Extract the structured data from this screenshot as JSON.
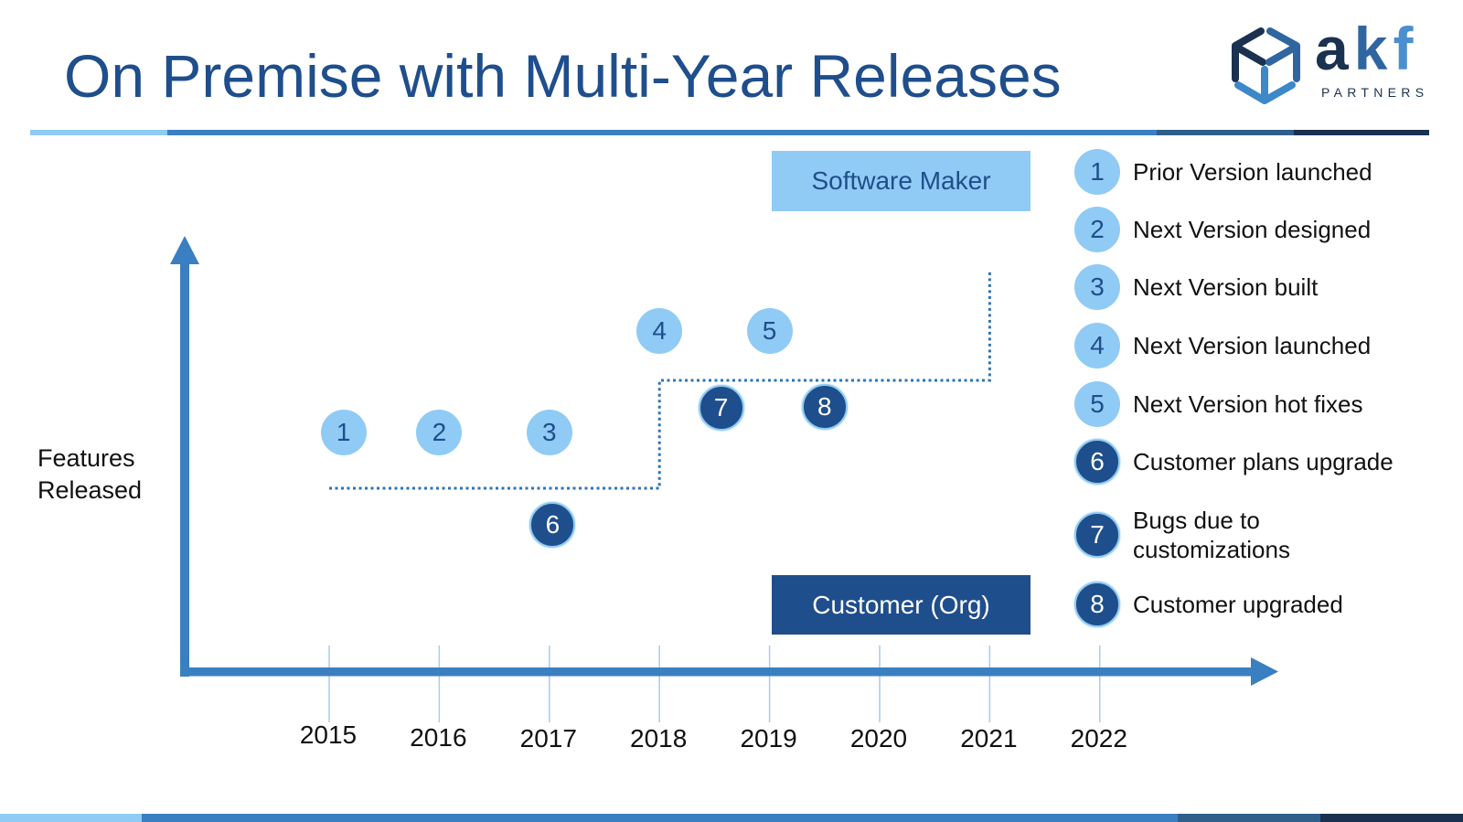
{
  "slide": {
    "title": "On Premise with Multi-Year Releases"
  },
  "logo": {
    "icon": "cube-icon",
    "wordmark": {
      "a": "a",
      "k": "k",
      "f": "f"
    },
    "tagline": "PARTNERS"
  },
  "colors": {
    "navy": "#1F4E8C",
    "light": "#90CBF5",
    "axis": "#3A7FC1",
    "dots": "#2E74B5",
    "tick": "#A9CBEB",
    "slate": "#2F5F8A",
    "deep": "#1B3150"
  },
  "lanes": {
    "software_maker": "Software Maker",
    "customer": "Customer (Org)"
  },
  "axis": {
    "y_label_lines": [
      "Features",
      "Released"
    ],
    "years": [
      "2015",
      "2016",
      "2017",
      "2018",
      "2019",
      "2020",
      "2021",
      "2022"
    ]
  },
  "timeline": {
    "release_steps": [
      {
        "from_year": 2015,
        "to_year": 2018,
        "level": 1
      },
      {
        "from_year": 2018,
        "to_year": 2021,
        "level": 2
      },
      {
        "from_year": 2021,
        "to_year": 2021,
        "level": 3
      }
    ],
    "markers": [
      {
        "number": "1",
        "year": 2015.13,
        "group": "software-maker",
        "style": "light"
      },
      {
        "number": "2",
        "year": 2016.0,
        "group": "software-maker",
        "style": "light"
      },
      {
        "number": "3",
        "year": 2017.0,
        "group": "software-maker",
        "style": "light"
      },
      {
        "number": "4",
        "year": 2018.0,
        "group": "software-maker",
        "style": "light"
      },
      {
        "number": "5",
        "year": 2019.0,
        "group": "software-maker",
        "style": "light"
      },
      {
        "number": "6",
        "year": 2017.03,
        "group": "customer",
        "style": "dark"
      },
      {
        "number": "7",
        "year": 2018.56,
        "group": "customer",
        "style": "dark"
      },
      {
        "number": "8",
        "year": 2019.5,
        "group": "customer",
        "style": "dark"
      }
    ]
  },
  "legend": {
    "items": [
      {
        "number": "1",
        "label_lines": [
          "Prior Version launched"
        ],
        "style": "light"
      },
      {
        "number": "2",
        "label_lines": [
          "Next Version designed"
        ],
        "style": "light"
      },
      {
        "number": "3",
        "label_lines": [
          "Next Version built"
        ],
        "style": "light"
      },
      {
        "number": "4",
        "label_lines": [
          "Next Version launched"
        ],
        "style": "light"
      },
      {
        "number": "5",
        "label_lines": [
          "Next Version hot fixes"
        ],
        "style": "light"
      },
      {
        "number": "6",
        "label_lines": [
          "Customer plans upgrade"
        ],
        "style": "dark"
      },
      {
        "number": "7",
        "label_lines": [
          "Bugs due to",
          "customizations"
        ],
        "style": "dark"
      },
      {
        "number": "8",
        "label_lines": [
          "Customer upgraded"
        ],
        "style": "dark"
      }
    ]
  }
}
